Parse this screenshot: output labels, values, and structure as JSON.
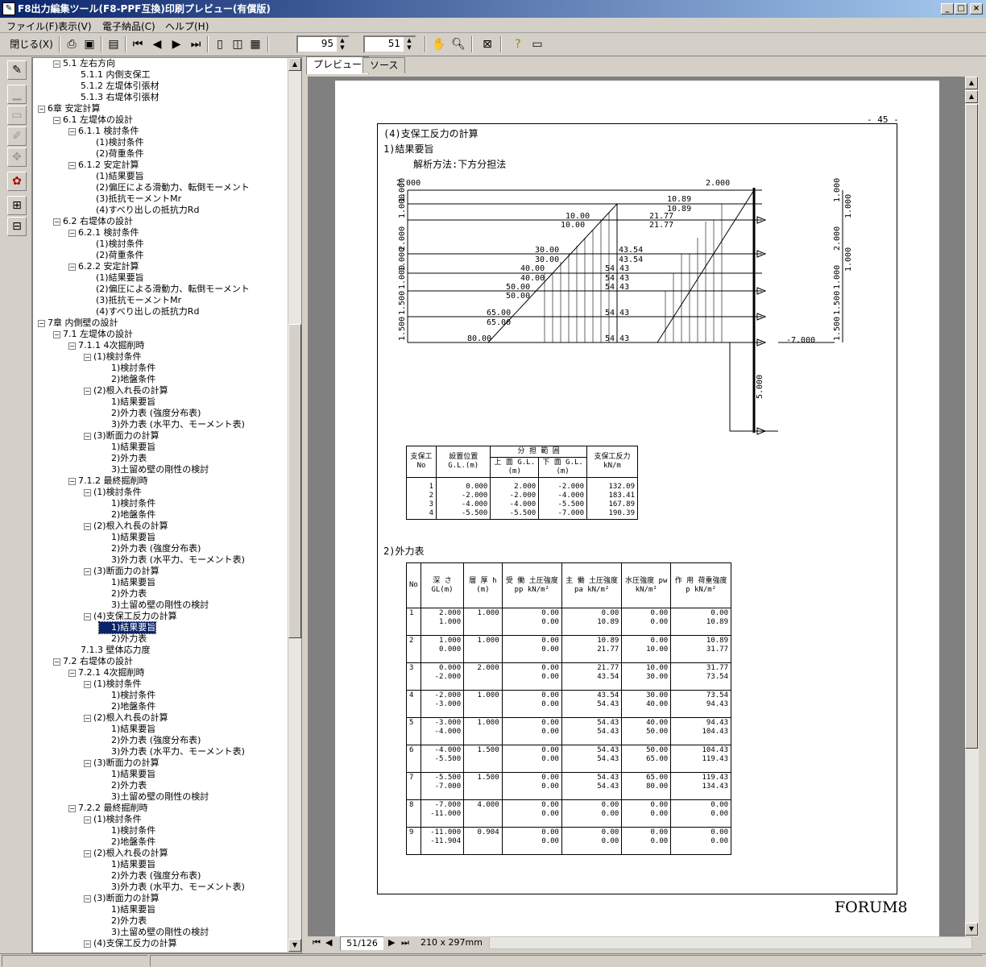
{
  "window": {
    "title": "F8出力編集ツール(F8-PPF互換)印刷プレビュー(有償版)",
    "icon": "edit-icon"
  },
  "menu": [
    "ファイル(F)",
    "表示(V)",
    "電子納品(C)",
    "ヘルプ(H)"
  ],
  "toolbar": {
    "close_label": "閉じる(X)",
    "zoom": "95",
    "page": "51"
  },
  "tree": [
    {
      "lvl": 1,
      "box": "-",
      "t": "5.1 左右方向"
    },
    {
      "lvl": 2,
      "box": "",
      "t": "5.1.1 内側支保工"
    },
    {
      "lvl": 2,
      "box": "",
      "t": "5.1.2 左堤体引張材"
    },
    {
      "lvl": 2,
      "box": "",
      "t": "5.1.3 右堤体引張材"
    },
    {
      "lvl": 0,
      "box": "-",
      "t": "6章 安定計算"
    },
    {
      "lvl": 1,
      "box": "-",
      "t": "6.1 左堤体の設計"
    },
    {
      "lvl": 2,
      "box": "-",
      "t": "6.1.1 検討条件"
    },
    {
      "lvl": 3,
      "box": "",
      "t": "(1)検討条件"
    },
    {
      "lvl": 3,
      "box": "",
      "t": "(2)荷重条件"
    },
    {
      "lvl": 2,
      "box": "-",
      "t": "6.1.2 安定計算"
    },
    {
      "lvl": 3,
      "box": "",
      "t": "(1)結果要旨"
    },
    {
      "lvl": 3,
      "box": "",
      "t": "(2)偏圧による滑動力、転倒モーメント"
    },
    {
      "lvl": 3,
      "box": "",
      "t": "(3)抵抗モーメントMr"
    },
    {
      "lvl": 3,
      "box": "",
      "t": "(4)すべり出しの抵抗力Rd"
    },
    {
      "lvl": 1,
      "box": "-",
      "t": "6.2 右堤体の設計"
    },
    {
      "lvl": 2,
      "box": "-",
      "t": "6.2.1 検討条件"
    },
    {
      "lvl": 3,
      "box": "",
      "t": "(1)検討条件"
    },
    {
      "lvl": 3,
      "box": "",
      "t": "(2)荷重条件"
    },
    {
      "lvl": 2,
      "box": "-",
      "t": "6.2.2 安定計算"
    },
    {
      "lvl": 3,
      "box": "",
      "t": "(1)結果要旨"
    },
    {
      "lvl": 3,
      "box": "",
      "t": "(2)偏圧による滑動力、転倒モーメント"
    },
    {
      "lvl": 3,
      "box": "",
      "t": "(3)抵抗モーメントMr"
    },
    {
      "lvl": 3,
      "box": "",
      "t": "(4)すべり出しの抵抗力Rd"
    },
    {
      "lvl": 0,
      "box": "-",
      "t": "7章 内側壁の設計"
    },
    {
      "lvl": 1,
      "box": "-",
      "t": "7.1 左堤体の設計"
    },
    {
      "lvl": 2,
      "box": "-",
      "t": "7.1.1 4次掘削時"
    },
    {
      "lvl": 3,
      "box": "-",
      "t": "(1)検討条件"
    },
    {
      "lvl": 4,
      "box": "",
      "t": "1)検討条件"
    },
    {
      "lvl": 4,
      "box": "",
      "t": "2)地盤条件"
    },
    {
      "lvl": 3,
      "box": "-",
      "t": "(2)根入れ長の計算"
    },
    {
      "lvl": 4,
      "box": "",
      "t": "1)結果要旨"
    },
    {
      "lvl": 4,
      "box": "",
      "t": "2)外力表 (強度分布表)"
    },
    {
      "lvl": 4,
      "box": "",
      "t": "3)外力表 (水平力、モーメント表)"
    },
    {
      "lvl": 3,
      "box": "-",
      "t": "(3)断面力の計算"
    },
    {
      "lvl": 4,
      "box": "",
      "t": "1)結果要旨"
    },
    {
      "lvl": 4,
      "box": "",
      "t": "2)外力表"
    },
    {
      "lvl": 4,
      "box": "",
      "t": "3)土留め壁の剛性の検討"
    },
    {
      "lvl": 2,
      "box": "-",
      "t": "7.1.2 最終掘削時"
    },
    {
      "lvl": 3,
      "box": "-",
      "t": "(1)検討条件"
    },
    {
      "lvl": 4,
      "box": "",
      "t": "1)検討条件"
    },
    {
      "lvl": 4,
      "box": "",
      "t": "2)地盤条件"
    },
    {
      "lvl": 3,
      "box": "-",
      "t": "(2)根入れ長の計算"
    },
    {
      "lvl": 4,
      "box": "",
      "t": "1)結果要旨"
    },
    {
      "lvl": 4,
      "box": "",
      "t": "2)外力表 (強度分布表)"
    },
    {
      "lvl": 4,
      "box": "",
      "t": "3)外力表 (水平力、モーメント表)"
    },
    {
      "lvl": 3,
      "box": "-",
      "t": "(3)断面力の計算"
    },
    {
      "lvl": 4,
      "box": "",
      "t": "1)結果要旨"
    },
    {
      "lvl": 4,
      "box": "",
      "t": "2)外力表"
    },
    {
      "lvl": 4,
      "box": "",
      "t": "3)土留め壁の剛性の検討"
    },
    {
      "lvl": 3,
      "box": "-",
      "t": "(4)支保工反力の計算"
    },
    {
      "lvl": 4,
      "box": "",
      "t": "1)結果要旨",
      "sel": true
    },
    {
      "lvl": 4,
      "box": "",
      "t": "2)外力表"
    },
    {
      "lvl": 2,
      "box": "",
      "t": "7.1.3 壁体応力度"
    },
    {
      "lvl": 1,
      "box": "-",
      "t": "7.2 右堤体の設計"
    },
    {
      "lvl": 2,
      "box": "-",
      "t": "7.2.1 4次掘削時"
    },
    {
      "lvl": 3,
      "box": "-",
      "t": "(1)検討条件"
    },
    {
      "lvl": 4,
      "box": "",
      "t": "1)検討条件"
    },
    {
      "lvl": 4,
      "box": "",
      "t": "2)地盤条件"
    },
    {
      "lvl": 3,
      "box": "-",
      "t": "(2)根入れ長の計算"
    },
    {
      "lvl": 4,
      "box": "",
      "t": "1)結果要旨"
    },
    {
      "lvl": 4,
      "box": "",
      "t": "2)外力表 (強度分布表)"
    },
    {
      "lvl": 4,
      "box": "",
      "t": "3)外力表 (水平力、モーメント表)"
    },
    {
      "lvl": 3,
      "box": "-",
      "t": "(3)断面力の計算"
    },
    {
      "lvl": 4,
      "box": "",
      "t": "1)結果要旨"
    },
    {
      "lvl": 4,
      "box": "",
      "t": "2)外力表"
    },
    {
      "lvl": 4,
      "box": "",
      "t": "3)土留め壁の剛性の検討"
    },
    {
      "lvl": 2,
      "box": "-",
      "t": "7.2.2 最終掘削時"
    },
    {
      "lvl": 3,
      "box": "-",
      "t": "(1)検討条件"
    },
    {
      "lvl": 4,
      "box": "",
      "t": "1)検討条件"
    },
    {
      "lvl": 4,
      "box": "",
      "t": "2)地盤条件"
    },
    {
      "lvl": 3,
      "box": "-",
      "t": "(2)根入れ長の計算"
    },
    {
      "lvl": 4,
      "box": "",
      "t": "1)結果要旨"
    },
    {
      "lvl": 4,
      "box": "",
      "t": "2)外力表 (強度分布表)"
    },
    {
      "lvl": 4,
      "box": "",
      "t": "3)外力表 (水平力、モーメント表)"
    },
    {
      "lvl": 3,
      "box": "-",
      "t": "(3)断面力の計算"
    },
    {
      "lvl": 4,
      "box": "",
      "t": "1)結果要旨"
    },
    {
      "lvl": 4,
      "box": "",
      "t": "2)外力表"
    },
    {
      "lvl": 4,
      "box": "",
      "t": "3)土留め壁の剛性の検討"
    },
    {
      "lvl": 3,
      "box": "-",
      "t": "(4)支保工反力の計算"
    }
  ],
  "tabs": [
    "プレビュー",
    "ソース"
  ],
  "doc": {
    "page_no": "- 45 -",
    "heading": "(4)支保工反力の計算",
    "sub1": "1)結果要旨",
    "method": "解析方法:下方分担法",
    "sub2": "2)外力表",
    "logo": "FORUM8",
    "diag": {
      "top_left": "2.000",
      "top_right": "2.000",
      "bottom_right": "-7.000",
      "embed": "5.000",
      "left_dims": [
        "1.000",
        "1.000",
        "2.000",
        "1.000",
        "1.000",
        "1.500",
        "1.500"
      ],
      "right_dims": [
        "1.000",
        "1.000",
        "2.000",
        "1.000",
        "1.000",
        "1.500",
        "1.500"
      ],
      "pa_left": [
        "10.89",
        "10.89",
        "21.77",
        "21.77",
        "43.54",
        "43.54",
        "54.43",
        "54.43",
        "54.43",
        "54.43",
        "54.43"
      ],
      "pp_left": [
        "10.00",
        "10.00",
        "30.00",
        "30.00",
        "40.00",
        "40.00",
        "50.00",
        "50.00",
        "65.00",
        "65.00",
        "80.00"
      ]
    },
    "t1": {
      "h_no": "支保工 No",
      "h_pos": "設置位置 G.L.(m)",
      "h_range": "分 担 範 囲",
      "h_up": "上 面 G.L.(m)",
      "h_dn": "下 面 G.L.(m)",
      "h_r": "支保工反力 kN/m",
      "rows": [
        [
          "1",
          "0.000",
          "2.000",
          "-2.000",
          "132.09"
        ],
        [
          "2",
          "-2.000",
          "-2.000",
          "-4.000",
          "183.41"
        ],
        [
          "3",
          "-4.000",
          "-4.000",
          "-5.500",
          "167.89"
        ],
        [
          "4",
          "-5.500",
          "-5.500",
          "-7.000",
          "190.39"
        ]
      ]
    },
    "t2": {
      "h": [
        "No",
        "深 さ GL(m)",
        "層 厚 h (m)",
        "受 働 土圧強度 pp kN/m²",
        "主 働 土圧強度 pa kN/m²",
        "水圧強度 pw kN/m²",
        "作 用 荷重強度 p kN/m²"
      ],
      "rows": [
        [
          "1",
          "2.000\n1.000",
          "1.000",
          "0.00\n0.00",
          "0.00\n10.89",
          "0.00\n0.00",
          "0.00\n10.89"
        ],
        [
          "2",
          "1.000\n0.000",
          "1.000",
          "0.00\n0.00",
          "10.89\n21.77",
          "0.00\n10.00",
          "10.89\n31.77"
        ],
        [
          "3",
          "0.000\n-2.000",
          "2.000",
          "0.00\n0.00",
          "21.77\n43.54",
          "10.00\n30.00",
          "31.77\n73.54"
        ],
        [
          "4",
          "-2.000\n-3.000",
          "1.000",
          "0.00\n0.00",
          "43.54\n54.43",
          "30.00\n40.00",
          "73.54\n94.43"
        ],
        [
          "5",
          "-3.000\n-4.000",
          "1.000",
          "0.00\n0.00",
          "54.43\n54.43",
          "40.00\n50.00",
          "94.43\n104.43"
        ],
        [
          "6",
          "-4.000\n-5.500",
          "1.500",
          "0.00\n0.00",
          "54.43\n54.43",
          "50.00\n65.00",
          "104.43\n119.43"
        ],
        [
          "7",
          "-5.500\n-7.000",
          "1.500",
          "0.00\n0.00",
          "54.43\n54.43",
          "65.00\n80.00",
          "119.43\n134.43"
        ],
        [
          "8",
          "-7.000\n-11.000",
          "4.000",
          "0.00\n0.00",
          "0.00\n0.00",
          "0.00\n0.00",
          "0.00\n0.00"
        ],
        [
          "9",
          "-11.000\n-11.904",
          "0.904",
          "0.00\n0.00",
          "0.00\n0.00",
          "0.00\n0.00",
          "0.00\n0.00"
        ]
      ]
    }
  },
  "pagebar": {
    "page": "51/126",
    "size": "210 x 297mm"
  }
}
